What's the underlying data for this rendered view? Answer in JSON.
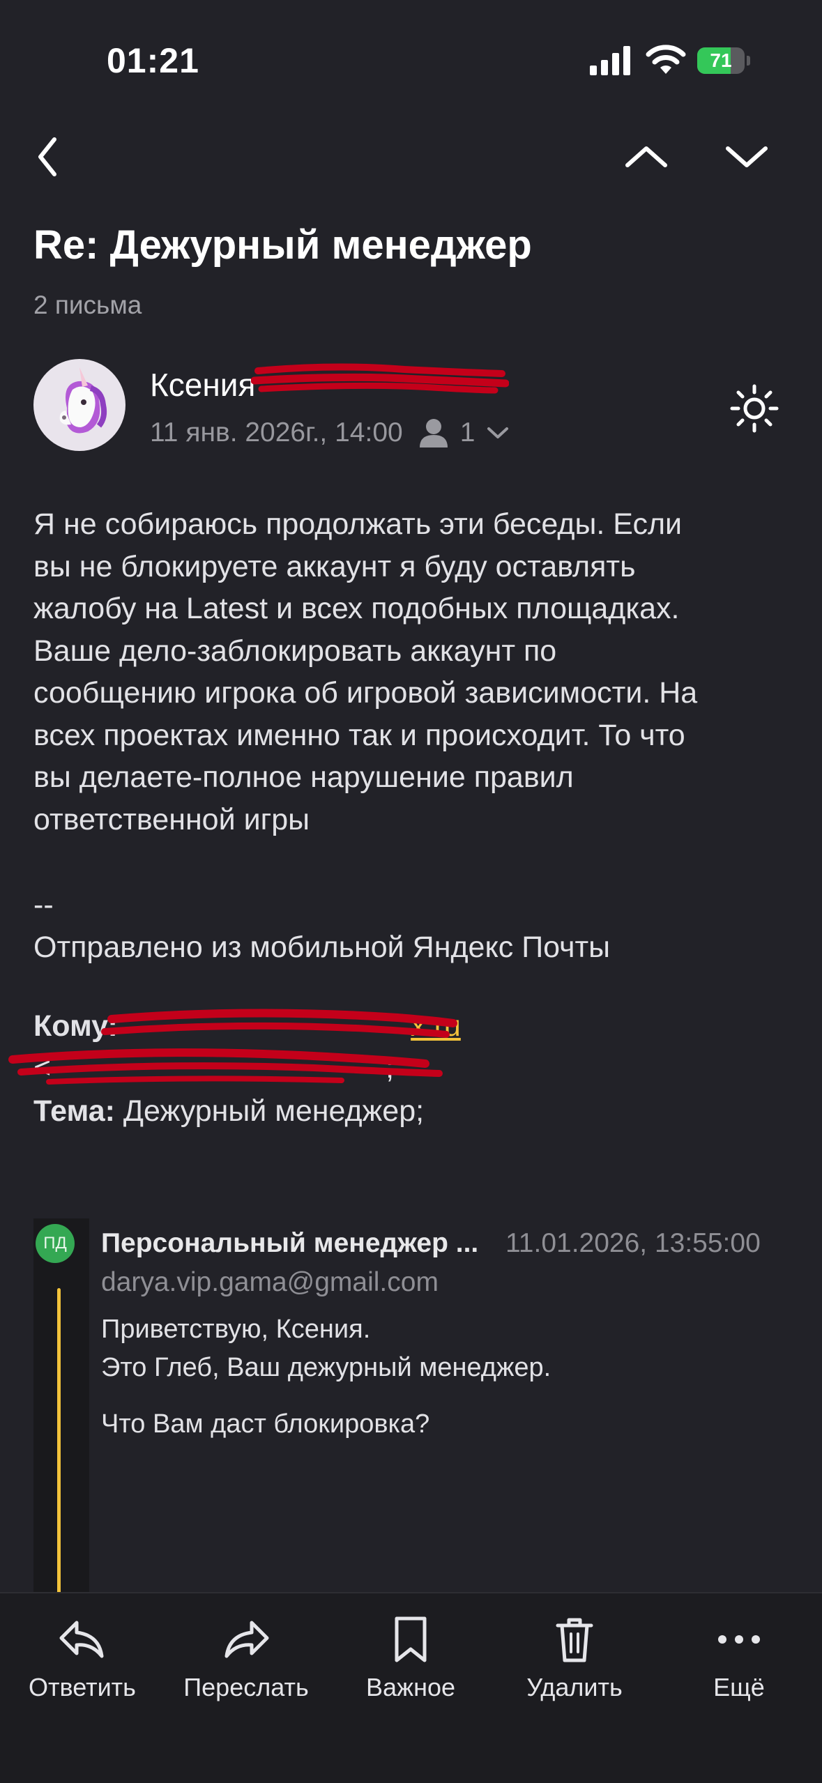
{
  "status_bar": {
    "time": "01:21",
    "battery": "71",
    "battery_level": 0.71
  },
  "nav": {
    "back_icon": "chevron-left-icon",
    "prev_icon": "chevron-up-icon",
    "next_icon": "chevron-down-icon"
  },
  "thread": {
    "subject": "Re: Дежурный менеджер",
    "count": "2 письма"
  },
  "message": {
    "sender_name": "Ксения",
    "date": "11 янв. 2026г., 14:00",
    "recipients_count": "1",
    "body": "Я не собираюсь продолжать эти беседы. Если\nвы не блокируете аккаунт я буду оставлять\nжалобу на Latest и всех подобных площадках.\nВаше дело-заблокировать аккаунт по\nсообщению игрока об игровой зависимости. На\nвсех проектах именно так и происходит. То что\nвы делаете-полное нарушение правил\nответственной игры",
    "signature": "--\nОтправлено из мобильной Яндекс Почты",
    "to_label": "Кому:",
    "to_link_suffix": "x.ru",
    "to_line2_suffix": ";",
    "topic_label": "Тема:",
    "topic_value": "Дежурный менеджер;"
  },
  "quoted": {
    "initials": "ПД",
    "sender": "Персональный менеджер ...",
    "date": "11.01.2026, 13:55:00",
    "email": "darya.vip.gama@gmail.com",
    "body": "Приветствую, Ксения.\nЭто Глеб, Ваш дежурный менеджер.",
    "question": "Что Вам даст блокировка?"
  },
  "toolbar": {
    "reply": "Ответить",
    "forward": "Переслать",
    "important": "Важное",
    "delete": "Удалить",
    "more": "Ещё"
  },
  "colors": {
    "background": "#222228",
    "accent_link": "#f3c33b",
    "battery_green": "#34c759",
    "quote_avatar": "#34a853",
    "redaction": "#c4001a"
  }
}
